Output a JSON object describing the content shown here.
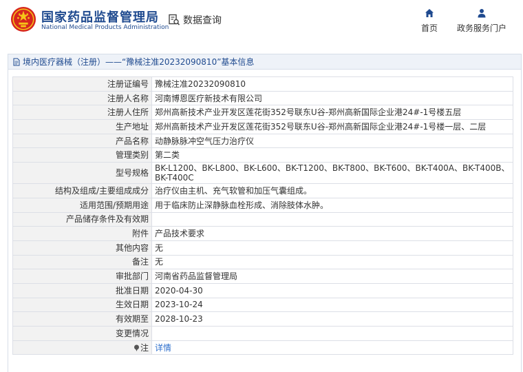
{
  "header": {
    "brand_cn": "国家药品监督管理局",
    "brand_en": "National Medical Products Administration",
    "search_label": "数据查询",
    "nav": [
      {
        "label": "首页",
        "icon": "home-icon"
      },
      {
        "label": "政务服务门户",
        "icon": "user-icon"
      }
    ]
  },
  "panel": {
    "title": "境内医疗器械（注册）——“豫械注准20232090810”基本信息"
  },
  "rows": [
    {
      "label": "注册证编号",
      "value": "豫械注准20232090810"
    },
    {
      "label": "注册人名称",
      "value": "河南博恩医疗新技术有限公司"
    },
    {
      "label": "注册人住所",
      "value": "郑州高新技术产业开发区莲花街352号联东U谷-郑州高新国际企业港24#-1号楼五层"
    },
    {
      "label": "生产地址",
      "value": "郑州高新技术产业开发区莲花街352号联东U谷-郑州高新国际企业港24#-1号楼一层、二层"
    },
    {
      "label": "产品名称",
      "value": "动静脉脉冲空气压力治疗仪"
    },
    {
      "label": "管理类别",
      "value": "第二类"
    },
    {
      "label": "型号规格",
      "value": "BK-L1200、BK-L800、BK-L600、BK-T1200、BK-T800、BK-T600、BK-T400A、BK-T400B、BK-T400C"
    },
    {
      "label": "结构及组成/主要组成成分",
      "value": "治疗仪由主机、充气软管和加压气囊组成。"
    },
    {
      "label": "适用范围/预期用途",
      "value": "用于临床防止深静脉血栓形成、消除肢体水肿。"
    },
    {
      "label": "产品储存条件及有效期",
      "value": ""
    },
    {
      "label": "附件",
      "value": "产品技术要求"
    },
    {
      "label": "其他内容",
      "value": "无"
    },
    {
      "label": "备注",
      "value": "无"
    },
    {
      "label": "审批部门",
      "value": "河南省药品监督管理局"
    },
    {
      "label": "批准日期",
      "value": "2020-04-30"
    },
    {
      "label": "生效日期",
      "value": "2023-10-24"
    },
    {
      "label": "有效期至",
      "value": "2028-10-23"
    },
    {
      "label": "变更情况",
      "value": ""
    }
  ],
  "note": {
    "label": "注",
    "link": "详情"
  },
  "colors": {
    "brand_blue": "#1f4a8f",
    "link_blue": "#2e6fcc",
    "emblem_red": "#d7261e",
    "emblem_gold": "#f5c518",
    "label_bg": "#f2f2f2"
  }
}
